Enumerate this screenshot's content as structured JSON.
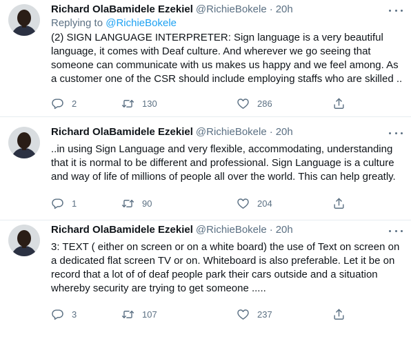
{
  "tweets": [
    {
      "name": "Richard OlaBamidele Ezekiel",
      "handle": "@RichieBokele",
      "separator": "·",
      "time": "20h",
      "replying_prefix": "Replying to",
      "replying_to": "@RichieBokele",
      "text": "(2) SIGN LANGUAGE INTERPRETER: Sign language is a very beautiful language, it comes with Deaf culture. And wherever we go seeing that someone can communicate with us makes us happy and we feel among. As a customer one of the CSR should include employing staffs who are skilled ..",
      "replies": "2",
      "retweets": "130",
      "likes": "286"
    },
    {
      "name": "Richard OlaBamidele Ezekiel",
      "handle": "@RichieBokele",
      "separator": "·",
      "time": "20h",
      "text": "..in using Sign Language and very flexible, accommodating, understanding that it is normal to be different and professional. Sign Language is a culture and way of life of millions of people all over the world. This can help greatly.",
      "replies": "1",
      "retweets": "90",
      "likes": "204"
    },
    {
      "name": "Richard OlaBamidele Ezekiel",
      "handle": "@RichieBokele",
      "separator": "·",
      "time": "20h",
      "text": "3: TEXT ( either on screen or on a white board) the use of Text on screen on a dedicated flat screen TV or on. Whiteboard is also preferable. Let it be on record that a lot of of deaf people park their cars outside and a situation whereby security are trying to get someone .....",
      "replies": "3",
      "retweets": "107",
      "likes": "237"
    }
  ],
  "colors": {
    "secondary_text": "#5b7083",
    "link": "#1da1f2",
    "divider": "#e6ecf0"
  },
  "icons": [
    "more-options-icon",
    "reply-icon",
    "retweet-icon",
    "like-icon",
    "share-icon"
  ]
}
